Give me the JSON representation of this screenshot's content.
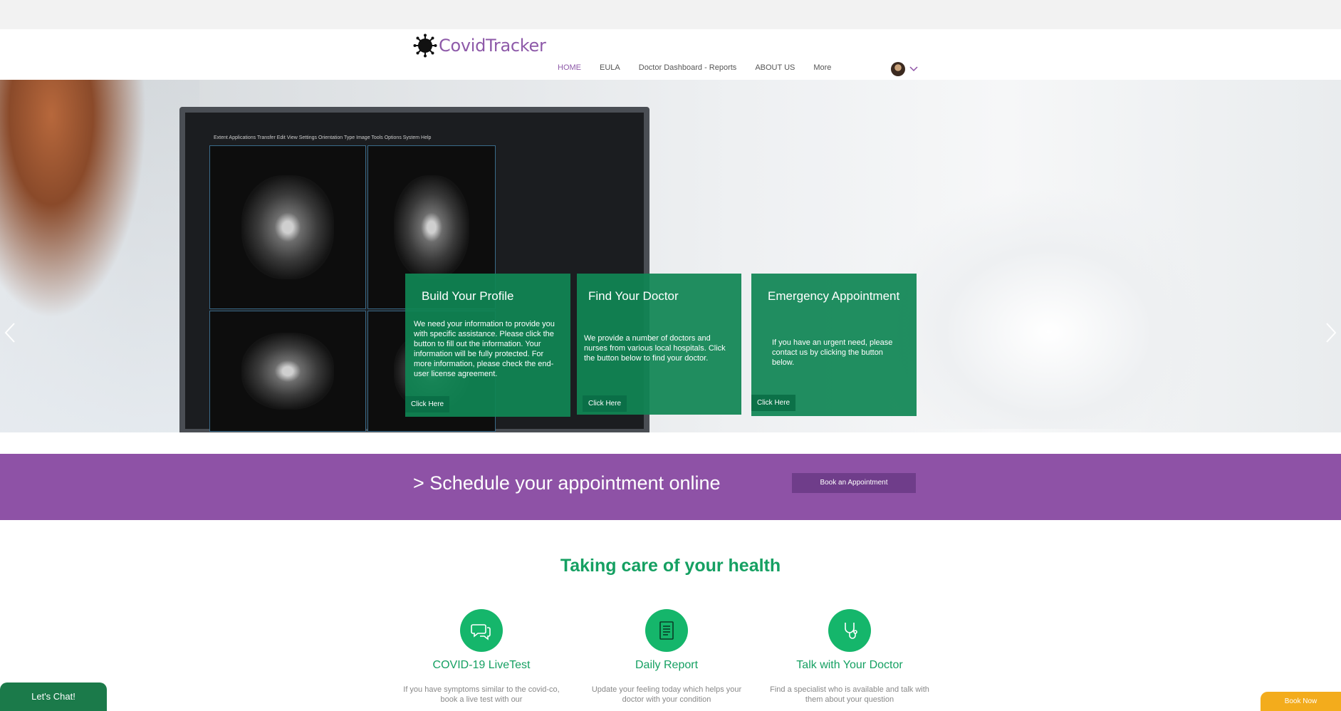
{
  "header": {
    "brand": "CovidTracker",
    "nav": [
      {
        "label": "HOME"
      },
      {
        "label": "EULA"
      },
      {
        "label": "Doctor Dashboard - Reports"
      },
      {
        "label": "ABOUT US"
      },
      {
        "label": "More"
      }
    ]
  },
  "hero": {
    "monitor_menu": "Extent  Applications  Transfer  Edit  View  Settings  Orientation  Type  Image  Tools  Options  System  Help",
    "cards": [
      {
        "title": "Build Your Profile",
        "text": "We need your information to provide you with specific assistance. Please click the button to fill out the information. Your information will be fully protected. For more information, please check the end-user license agreement.",
        "button": "Click Here"
      },
      {
        "title": "Find Your Doctor",
        "text": "We provide a number of doctors and nurses from various local hospitals. Click the button below to find your doctor.",
        "button": "Click Here"
      },
      {
        "title": "Emergency Appointment",
        "text": "If you have an urgent need, please contact us by clicking the button below.",
        "button": "Click Here"
      }
    ]
  },
  "schedule": {
    "text": "> Schedule your appointment online",
    "button": "Book an Appointment"
  },
  "care": {
    "title": "Taking care of your health",
    "features": [
      {
        "title": "COVID-19 LiveTest",
        "desc": "If you have symptoms similar to the covid-co, book a live test with our",
        "icon": "chat-bubbles-icon"
      },
      {
        "title": "Daily Report",
        "desc": "Update your feeling today which helps your doctor with your condition",
        "icon": "report-list-icon"
      },
      {
        "title": "Talk with Your Doctor",
        "desc": "Find a specialist who is available and talk with them about your question",
        "icon": "stethoscope-icon"
      }
    ]
  },
  "widgets": {
    "chat": "Let's Chat!",
    "book_now": "Book Now"
  },
  "colors": {
    "brand_purple": "#8e52a6",
    "card_green": "#108554",
    "accent_green": "#15a062",
    "book_now": "#f3ac1c"
  }
}
